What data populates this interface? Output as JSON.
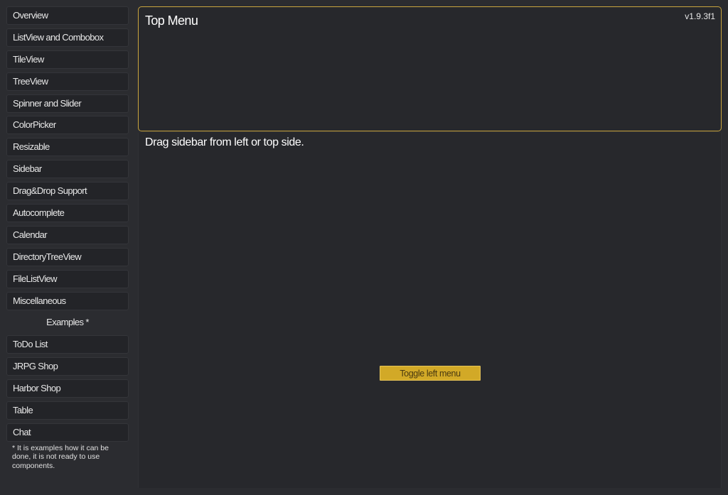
{
  "sidebar": {
    "items": [
      {
        "label": "Overview"
      },
      {
        "label": "ListView and Combobox"
      },
      {
        "label": "TileView"
      },
      {
        "label": "TreeView"
      },
      {
        "label": "Spinner and Slider"
      },
      {
        "label": "ColorPicker"
      },
      {
        "label": "Resizable"
      },
      {
        "label": "Sidebar"
      },
      {
        "label": "Drag&Drop Support"
      },
      {
        "label": "Autocomplete"
      },
      {
        "label": "Calendar"
      },
      {
        "label": "DirectoryTreeView"
      },
      {
        "label": "FileListView"
      },
      {
        "label": "Miscellaneous"
      }
    ],
    "examples_header": "Examples *",
    "examples": [
      {
        "label": "ToDo List"
      },
      {
        "label": "JRPG Shop"
      },
      {
        "label": "Harbor Shop"
      },
      {
        "label": "Table"
      },
      {
        "label": "Chat"
      }
    ],
    "note": "* It is examples how it can be done, it is not ready to use components."
  },
  "top_menu": {
    "title": "Top Menu",
    "version": "v1.9.3f1"
  },
  "main": {
    "hint": "Drag sidebar from left or top side.",
    "toggle_label": "Toggle left menu"
  },
  "colors": {
    "accent": "#d2a927",
    "panel_border": "#c9a53e",
    "background": "#2b2c30",
    "panel": "#27282c"
  }
}
